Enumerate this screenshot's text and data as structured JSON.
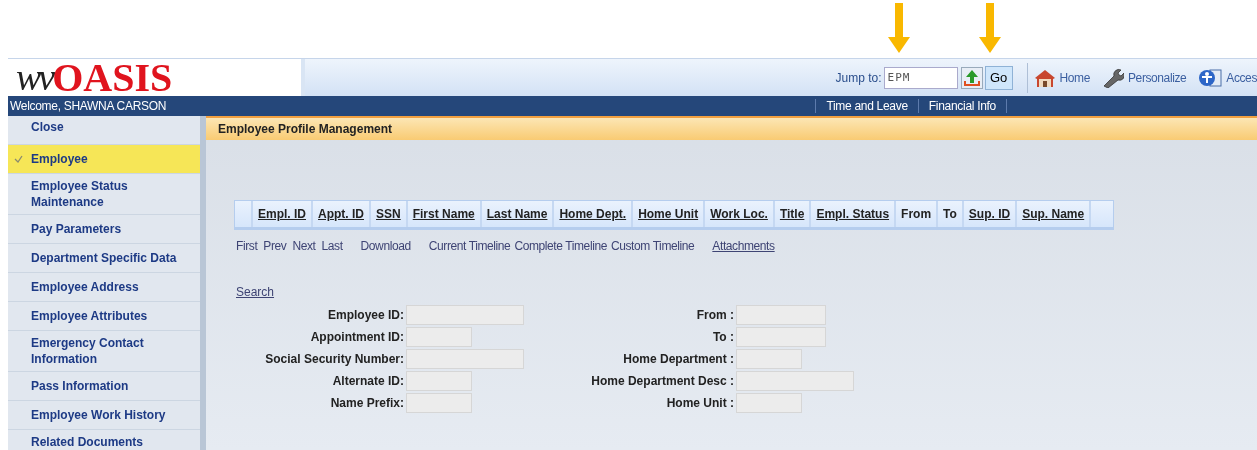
{
  "header": {
    "logo_prefix": "wv",
    "logo_name": "OASIS",
    "jump_label": "Jump to:",
    "jump_value": "EPM",
    "go_button": "Go",
    "links": [
      {
        "kind": "home",
        "label": "Home"
      },
      {
        "kind": "personalize",
        "label": "Personalize"
      },
      {
        "kind": "access",
        "label": "Acces"
      }
    ]
  },
  "nav_bar": {
    "welcome": "Welcome, SHAWNA CARSON",
    "links": [
      "Time and Leave",
      "Financial Info"
    ]
  },
  "sidebar": {
    "close": "Close",
    "items": [
      {
        "label": "Employee",
        "selected": true
      },
      {
        "label": "Employee Status Maintenance",
        "selected": false
      },
      {
        "label": "Pay Parameters",
        "selected": false
      },
      {
        "label": "Department Specific Data",
        "selected": false
      },
      {
        "label": "Employee Address",
        "selected": false
      },
      {
        "label": "Employee Attributes",
        "selected": false
      },
      {
        "label": "Emergency Contact Information",
        "selected": false
      },
      {
        "label": "Pass Information",
        "selected": false
      },
      {
        "label": "Employee Work History",
        "selected": false
      },
      {
        "label": "Related Documents",
        "selected": false
      }
    ]
  },
  "page_title": "Employee Profile Management",
  "table": {
    "columns": [
      {
        "label": "Empl. ID",
        "sortable": true
      },
      {
        "label": "Appt. ID",
        "sortable": true
      },
      {
        "label": "SSN",
        "sortable": true
      },
      {
        "label": "First Name",
        "sortable": true
      },
      {
        "label": "Last Name",
        "sortable": true
      },
      {
        "label": "Home Dept.",
        "sortable": true
      },
      {
        "label": "Home Unit",
        "sortable": true
      },
      {
        "label": "Work Loc.",
        "sortable": true
      },
      {
        "label": "Title",
        "sortable": true
      },
      {
        "label": "Empl. Status",
        "sortable": true
      },
      {
        "label": "From",
        "sortable": false
      },
      {
        "label": "To",
        "sortable": false
      },
      {
        "label": "Sup. ID",
        "sortable": true
      },
      {
        "label": "Sup. Name",
        "sortable": true
      }
    ]
  },
  "actions": [
    [
      {
        "label": "First",
        "underlined": false
      },
      {
        "label": "Prev",
        "underlined": false
      },
      {
        "label": "Next",
        "underlined": false
      },
      {
        "label": "Last",
        "underlined": false
      }
    ],
    [
      {
        "label": "Download",
        "underlined": false
      }
    ],
    [
      {
        "label": "Current Timeline",
        "underlined": false
      },
      {
        "label": "Complete Timeline",
        "underlined": false
      },
      {
        "label": "Custom Timeline",
        "underlined": false
      }
    ],
    [
      {
        "label": "Attachments",
        "underlined": true
      }
    ]
  ],
  "search": {
    "link": "Search",
    "left_fields": [
      {
        "label": "Employee ID:",
        "kind": "wide"
      },
      {
        "label": "Appointment ID:",
        "kind": "narrow"
      },
      {
        "label": "Social Security Number:",
        "kind": "wide"
      },
      {
        "label": "Alternate ID:",
        "kind": "narrow"
      },
      {
        "label": "Name Prefix:",
        "kind": "narrow"
      }
    ],
    "right_fields": [
      {
        "label": "From :",
        "kind": "medium"
      },
      {
        "label": "To :",
        "kind": "medium"
      },
      {
        "label": "Home Department :",
        "kind": "narrow"
      },
      {
        "label": "Home Department Desc :",
        "kind": "wide"
      },
      {
        "label": "Home Unit :",
        "kind": "narrow"
      }
    ]
  }
}
